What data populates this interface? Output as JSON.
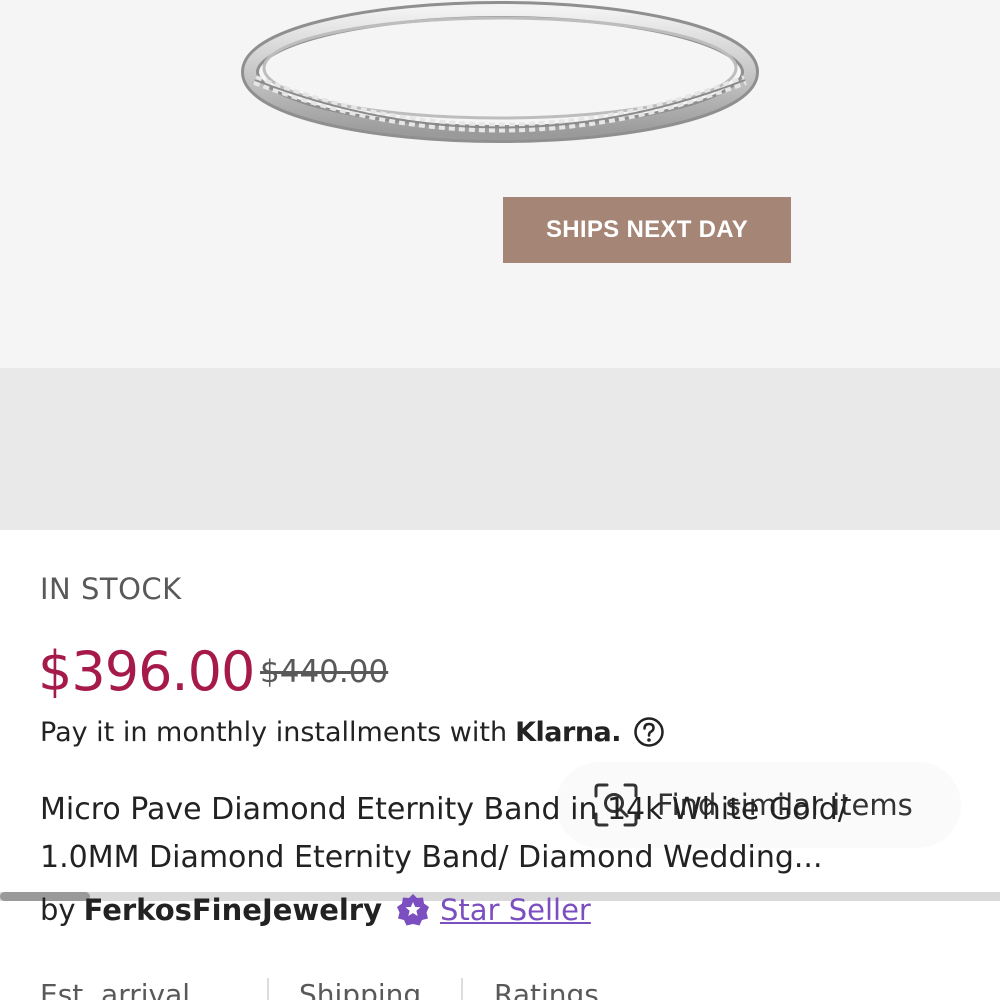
{
  "hero": {
    "badge": "SHIPS NEXT DAY"
  },
  "find_similar": {
    "label": "Find similar items",
    "icon": "visual-search-icon"
  },
  "gallery": {
    "scroll_progress": 0.09
  },
  "product": {
    "stock_status": "IN STOCK",
    "price": "$396.00",
    "original_price": "$440.00",
    "installments_text": "Pay it in monthly installments with",
    "installments_brand": "Klarna.",
    "title": "Micro Pave Diamond Eternity Band in 14k White Gold/ 1.0MM Diamond Eternity Band/ Diamond Wedding...",
    "seller_prefix": "by",
    "seller_name": "FerkosFineJewelry",
    "seller_badge": "Star Seller"
  },
  "info_tabs": [
    "Est. arrival",
    "Shipping",
    "Ratings"
  ],
  "colors": {
    "price": "#a61a4b",
    "badge_bg": "#a58575",
    "star_seller": "#7b4fbf"
  }
}
